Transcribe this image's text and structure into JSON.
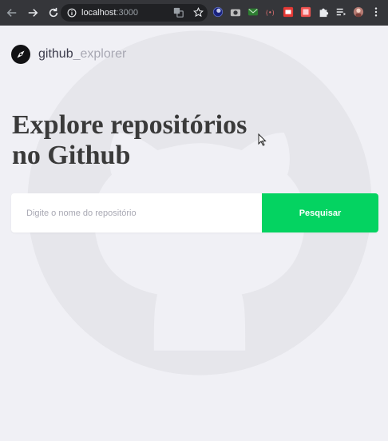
{
  "browser": {
    "url_host": "localhost",
    "url_port": ":3000"
  },
  "app": {
    "brand_bold": "github",
    "brand_light": "_explorer",
    "title_line1": "Explore repositórios",
    "title_line2": "no Github"
  },
  "search": {
    "placeholder": "Digite o nome do repositório",
    "button_label": "Pesquisar"
  },
  "colors": {
    "page_background": "#f0f0f5",
    "accent": "#04d361",
    "title": "#3a3a3a",
    "chrome": "#35363a"
  },
  "icons": {
    "back": "arrow-left-icon",
    "forward": "arrow-right-icon",
    "reload": "reload-icon",
    "site_info": "info-icon",
    "translate": "translate-icon",
    "bookmark": "star-icon",
    "brand": "compass-icon",
    "background": "github-logo-icon"
  }
}
